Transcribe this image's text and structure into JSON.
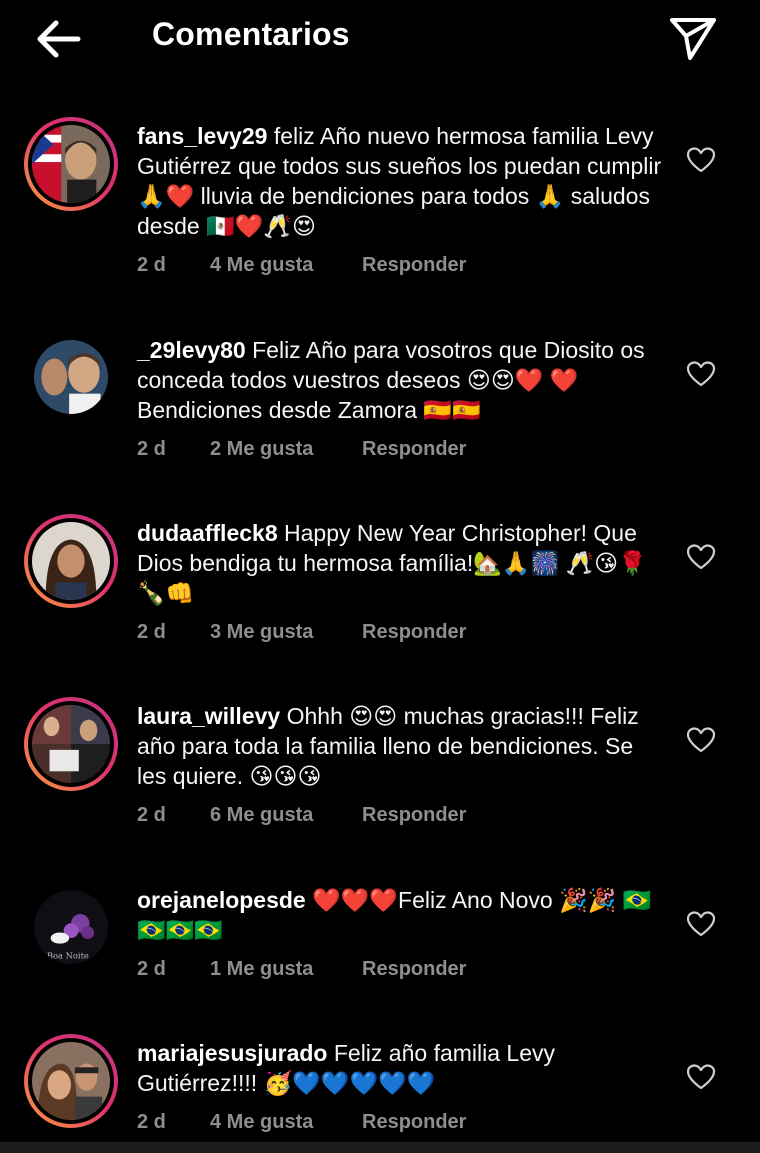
{
  "header": {
    "title": "Comentarios",
    "back_icon": "arrow-left-icon",
    "share_icon": "paper-plane-icon"
  },
  "comments": [
    {
      "username": "fans_levy29",
      "text": "feliz Año nuevo hermosa familia Levy Gutiérrez que todos sus sueños los puedan cumplir 🙏❤️ lluvia de bendiciones para todos 🙏 saludos desde 🇲🇽❤️🥂😍",
      "time": "2 d",
      "likes": "4 Me gusta",
      "reply": "Responder",
      "has_story": true
    },
    {
      "username": "_29levy80",
      "text": "Feliz Año para vosotros que Diosito os conceda todos vuestros deseos 😍😍❤️ ❤️ Bendiciones desde Zamora 🇪🇸🇪🇸",
      "time": "2 d",
      "likes": "2 Me gusta",
      "reply": "Responder",
      "has_story": false
    },
    {
      "username": "dudaaffleck8",
      "text": "Happy New Year Christopher! Que Dios bendiga tu hermosa família!🏡🙏🎆 🥂😘🌹🍾👊",
      "time": "2 d",
      "likes": "3 Me gusta",
      "reply": "Responder",
      "has_story": true
    },
    {
      "username": "laura_willevy",
      "text": "Ohhh 😍😍 muchas gracias!!! Feliz año para toda la familia lleno de bendiciones. Se les quiere. 😘😘😘",
      "time": "2 d",
      "likes": "6 Me gusta",
      "reply": "Responder",
      "has_story": true
    },
    {
      "username": "orejanelopesde",
      "text": "❤️❤️❤️Feliz Ano Novo 🎉🎉 🇧🇷🇧🇷🇧🇷🇧🇷",
      "time": "2 d",
      "likes": "1 Me gusta",
      "reply": "Responder",
      "has_story": false,
      "avatar_caption": "Boa Noite"
    },
    {
      "username": "mariajesusjurado",
      "text": "Feliz año familia Levy Gutiérrez!!!! 🥳💙💙💙💙💙",
      "time": "2 d",
      "likes": "4 Me gusta",
      "reply": "Responder",
      "has_story": true
    }
  ],
  "icons": {
    "like": "heart-outline-icon"
  },
  "colors": {
    "background": "#000000",
    "text": "#f5f5f5",
    "meta": "#8e8e8e",
    "story_ring_start": "#f9a03f",
    "story_ring_end": "#c13584"
  }
}
